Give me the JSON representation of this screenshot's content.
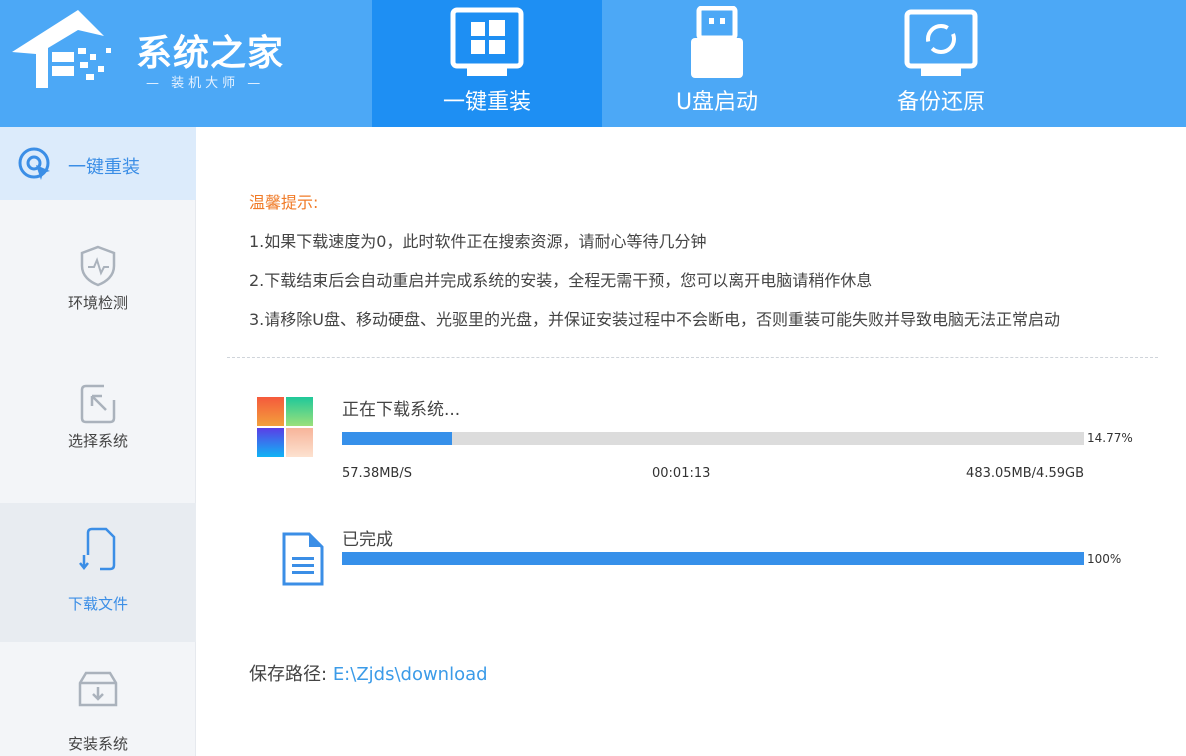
{
  "brand": {
    "name": "系统之家",
    "subtitle": "— 装机大师 —"
  },
  "nav_tabs": [
    {
      "label": "一键重装",
      "active": true
    },
    {
      "label": "U盘启动",
      "active": false
    },
    {
      "label": "备份还原",
      "active": false
    }
  ],
  "sidebar": {
    "items": [
      {
        "label": "一键重装"
      },
      {
        "label": "环境检测"
      },
      {
        "label": "选择系统"
      },
      {
        "label": "下载文件"
      },
      {
        "label": "安装系统"
      }
    ]
  },
  "tips": {
    "title": "温馨提示:",
    "lines": [
      "1.如果下载速度为0，此时软件正在搜索资源，请耐心等待几分钟",
      "2.下载结束后会自动重启并完成系统的安装，全程无需干预，您可以离开电脑请稍作休息",
      "3.请移除U盘、移动硬盘、光驱里的光盘，并保证安装过程中不会断电，否则重装可能失败并导致电脑无法正常启动"
    ]
  },
  "download": {
    "status": "正在下载系统...",
    "progress_percent": 14.77,
    "progress_label": "14.77%",
    "speed": "57.38MB/S",
    "elapsed": "00:01:13",
    "size": "483.05MB/4.59GB"
  },
  "complete": {
    "status": "已完成",
    "progress_percent": 100,
    "progress_label": "100%"
  },
  "save_path": {
    "label": "保存路径:",
    "value": "E:\\Zjds\\download"
  },
  "colors": {
    "header": "#4ca8f6",
    "active_tab": "#1e8ff3",
    "progress": "#3690ea",
    "tip_title": "#f07b28"
  }
}
